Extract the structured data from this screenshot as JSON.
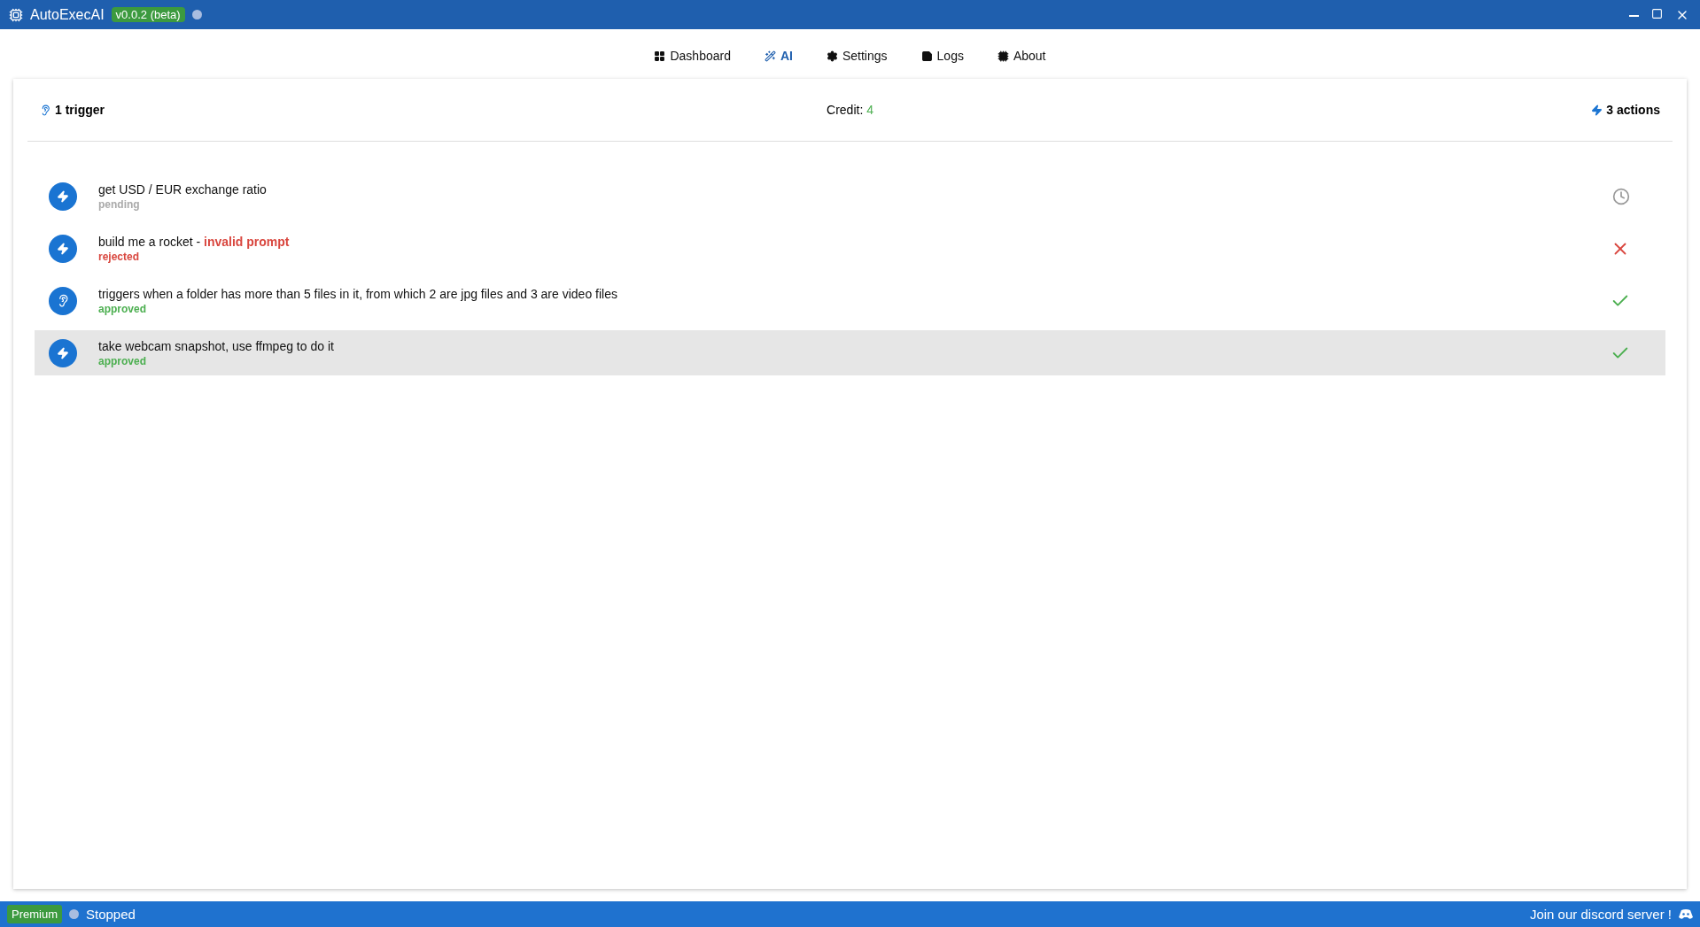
{
  "window": {
    "title": "AutoExecAI",
    "version": "v0.0.2 (beta)"
  },
  "nav": [
    {
      "label": "Dashboard",
      "selected": false
    },
    {
      "label": "AI",
      "selected": true
    },
    {
      "label": "Settings",
      "selected": false
    },
    {
      "label": "Logs",
      "selected": false
    },
    {
      "label": "About",
      "selected": false
    }
  ],
  "summary": {
    "triggers": "1 trigger",
    "credit_label": "Credit:",
    "credit_value": "4",
    "actions": "3 actions"
  },
  "prompts": [
    {
      "kind": "action",
      "title": "get USD / EUR exchange ratio",
      "status": "pending",
      "selected": false
    },
    {
      "kind": "action",
      "title": "build me a rocket -",
      "note": "invalid prompt",
      "status": "rejected",
      "selected": false
    },
    {
      "kind": "trigger",
      "title": "triggers when a folder has more than 5 files in it, from which 2 are jpg files and 3 are video files",
      "status": "approved",
      "selected": false
    },
    {
      "kind": "action",
      "title": "take webcam snapshot, use ffmpeg to do it",
      "status": "approved",
      "selected": true
    }
  ],
  "status_bar": {
    "plan": "Premium",
    "state": "Stopped",
    "running": false,
    "link": "Join our discord server !"
  }
}
